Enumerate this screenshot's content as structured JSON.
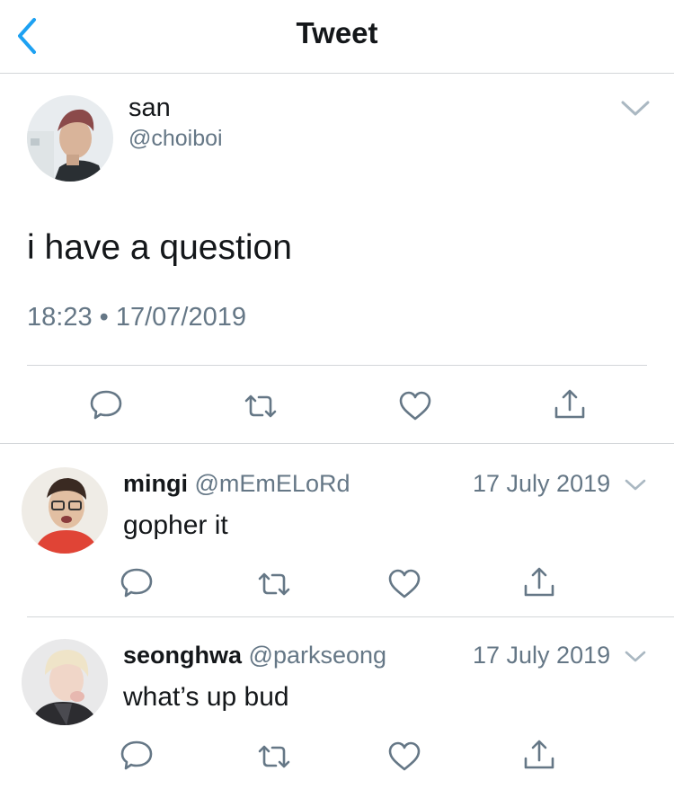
{
  "nav": {
    "title": "Tweet"
  },
  "tweet": {
    "name": "san",
    "handle": "@choiboi",
    "text": "i have a question",
    "time": "18:23",
    "separator": "•",
    "date": "17/07/2019"
  },
  "replies": [
    {
      "name": "mingi",
      "handle": "@mEmELoRd",
      "date": "17 July 2019",
      "text": "gopher it"
    },
    {
      "name": "seonghwa",
      "handle": "@parkseong",
      "date": "17 July 2019",
      "text": "what’s up bud"
    }
  ],
  "icons": {
    "back": "chevron-left-icon",
    "caret": "chevron-down-icon",
    "reply": "reply-icon",
    "retweet": "retweet-icon",
    "like": "heart-icon",
    "share": "share-icon"
  },
  "colors": {
    "accent": "#1da1f2",
    "icon": "#657786",
    "text": "#14171a",
    "divider": "#d3d6d9"
  }
}
